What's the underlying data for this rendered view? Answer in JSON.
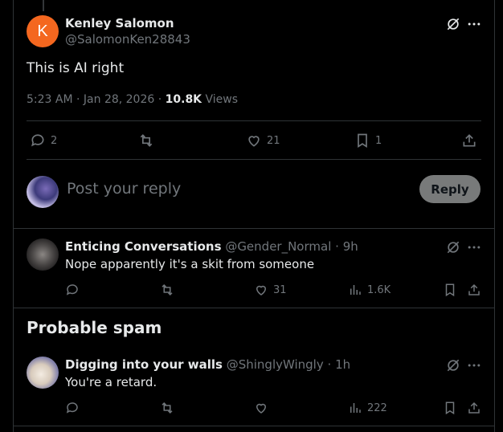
{
  "main_post": {
    "avatar_letter": "K",
    "avatar_color": "#f4671f",
    "author_name": "Kenley Salomon",
    "author_handle": "@SalomonKen28843",
    "text": "This is AI right",
    "time": "5:23 AM",
    "date": "Jan 28, 2026",
    "views_count": "10.8K",
    "views_label": "Views",
    "replies": "2",
    "retweets": "",
    "likes": "21",
    "bookmarks": "1"
  },
  "reply_box": {
    "placeholder": "Post your reply",
    "button_label": "Reply"
  },
  "replies": [
    {
      "author_name": "Enticing Conversations",
      "author_handle": "@Gender_Normal",
      "time": "9h",
      "text": "Nope apparently it's a skit from someone",
      "replies": "",
      "retweets": "",
      "likes": "31",
      "views": "1.6K"
    }
  ],
  "spam_section": {
    "title": "Probable spam",
    "items": [
      {
        "author_name": "Digging into your walls",
        "author_handle": "@ShinglyWingly",
        "time": "1h",
        "text": "You're a retard.",
        "replies": "",
        "retweets": "",
        "likes": "",
        "views": "222"
      }
    ]
  },
  "separator": "·",
  "colors": {
    "background": "#000000",
    "text": "#e7e9ea",
    "muted": "#71767b",
    "border": "#2f3336",
    "reply_button": "#787a7a"
  }
}
